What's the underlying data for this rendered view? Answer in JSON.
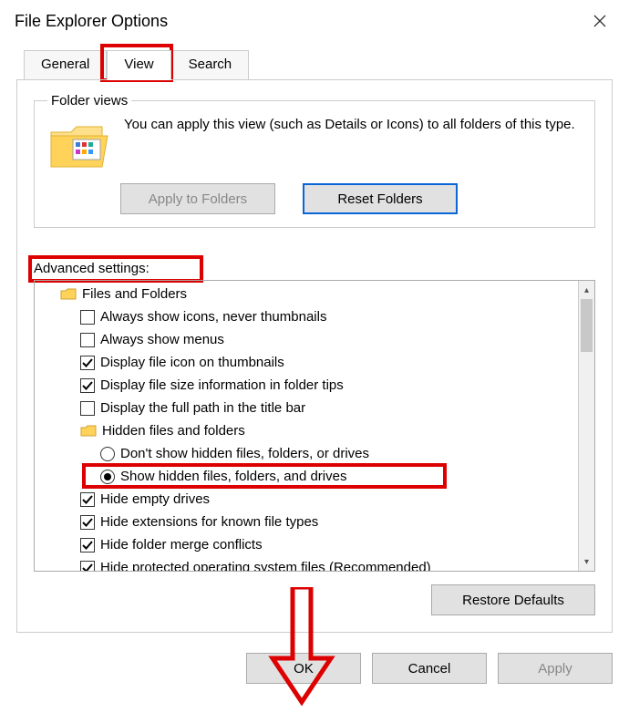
{
  "window": {
    "title": "File Explorer Options"
  },
  "tabs": {
    "general": "General",
    "view": "View",
    "search": "Search"
  },
  "folder_views": {
    "legend": "Folder views",
    "desc": "You can apply this view (such as Details or Icons) to all folders of this type.",
    "apply_btn": "Apply to Folders",
    "reset_btn": "Reset Folders"
  },
  "advanced": {
    "label": "Advanced settings:",
    "root": "Files and Folders",
    "items": [
      {
        "text": "Always show icons, never thumbnails",
        "checked": false
      },
      {
        "text": "Always show menus",
        "checked": false
      },
      {
        "text": "Display file icon on thumbnails",
        "checked": true
      },
      {
        "text": "Display file size information in folder tips",
        "checked": true
      },
      {
        "text": "Display the full path in the title bar",
        "checked": false
      }
    ],
    "hidden_group": "Hidden files and folders",
    "radios": [
      {
        "text": "Don't show hidden files, folders, or drives",
        "selected": false
      },
      {
        "text": "Show hidden files, folders, and drives",
        "selected": true
      }
    ],
    "after": [
      {
        "text": "Hide empty drives",
        "checked": true
      },
      {
        "text": "Hide extensions for known file types",
        "checked": true
      },
      {
        "text": "Hide folder merge conflicts",
        "checked": true
      },
      {
        "text": "Hide protected operating system files (Recommended)",
        "checked": true
      }
    ]
  },
  "restore_btn": "Restore Defaults",
  "buttons": {
    "ok": "OK",
    "cancel": "Cancel",
    "apply": "Apply"
  }
}
